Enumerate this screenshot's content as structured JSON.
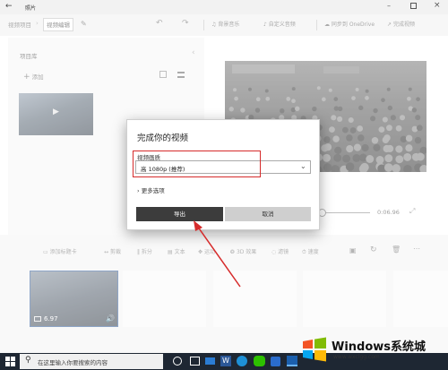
{
  "window": {
    "title": "照片",
    "back_icon": "back-arrow-icon",
    "controls": [
      "minimize-icon",
      "maximize-icon",
      "close-icon"
    ]
  },
  "toolbar": {
    "tab_project": "视频项目",
    "tab_edit": "视频编辑",
    "undo_icon": "undo-icon",
    "redo_icon": "redo-icon",
    "background_music": "背景音乐",
    "custom_audio": "自定义音频",
    "sync_onedrive": "同步到 OneDrive",
    "finish_video": "完成视频"
  },
  "library": {
    "title": "项目库",
    "add": "添加"
  },
  "preview": {
    "time": "0:06.96"
  },
  "storyboard": {
    "tools": [
      "添加标题卡",
      "剪裁",
      "拆分",
      "文本",
      "运动",
      "3D 效果",
      "滤镜",
      "速度"
    ],
    "clip_duration": "6.97"
  },
  "dialog": {
    "title": "完成你的视频",
    "quality_label": "视频画质",
    "quality_value": "高 1080p (推荐)",
    "more_options": "更多选项",
    "export_button": "导出",
    "cancel_button": "取消"
  },
  "annotation": {
    "highlight_color": "#d62b2b"
  },
  "taskbar": {
    "search_placeholder": "在这里输入你要搜索的内容"
  },
  "watermark": {
    "brand": "Windows系统城",
    "url": "www.wxclgg.com"
  }
}
